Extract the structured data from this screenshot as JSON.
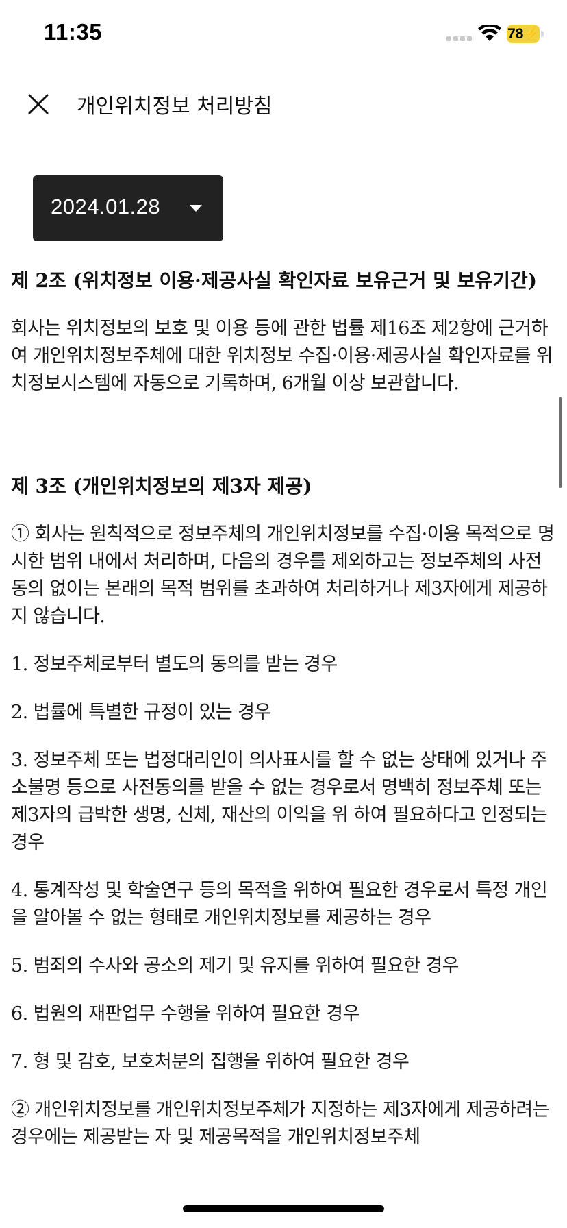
{
  "status_bar": {
    "time": "11:35",
    "battery_level": "78",
    "icons": [
      "cellular-signal-icon",
      "wifi-icon",
      "battery-charging-icon"
    ]
  },
  "header": {
    "title": "개인위치정보 처리방침",
    "close_icon": "close-icon"
  },
  "date_select": {
    "value": "2024.01.28",
    "icon": "caret-down-icon"
  },
  "articles": [
    {
      "title": "제 2조 (위치정보 이용·제공사실 확인자료 보유근거 및 보유기간)",
      "paragraphs": [
        "회사는 위치정보의 보호 및 이용 등에 관한 법률 제16조 제2항에 근거하여 개인위치정보주체에 대한 위치정보 수집·이용·제공사실 확인자료를 위치정보시스템에 자동으로 기록하며, 6개월 이상 보관합니다."
      ]
    },
    {
      "title": "제 3조 (개인위치정보의 제3자 제공)",
      "paragraphs": [
        "① 회사는 원칙적으로 정보주체의 개인위치정보를 수집·이용 목적으로 명시한 범위 내에서 처리하며, 다음의 경우를 제외하고는 정보주체의 사전 동의 없이는 본래의 목적 범위를 초과하여 처리하거나 제3자에게 제공하지 않습니다.",
        "1. 정보주체로부터 별도의 동의를 받는 경우",
        "2. 법률에 특별한 규정이 있는 경우",
        "3. 정보주체 또는 법정대리인이 의사표시를 할 수 없는 상태에 있거나 주소불명 등으로 사전동의를 받을 수 없는 경우로서 명백히 정보주체 또는 제3자의 급박한 생명, 신체, 재산의 이익을 위 하여 필요하다고 인정되는 경우",
        "4. 통계작성 및 학술연구 등의 목적을 위하여 필요한 경우로서 특정 개인을 알아볼 수 없는  형태로 개인위치정보를 제공하는 경우",
        "5. 범죄의 수사와 공소의 제기 및 유지를 위하여 필요한 경우",
        "6. 법원의 재판업무 수행을 위하여 필요한 경우",
        "7. 형 및 감호, 보호처분의 집행을 위하여 필요한 경우",
        "② 개인위치정보를 개인위치정보주체가 지정하는 제3자에게 제공하려는 경우에는 제공받는 자 및 제공목적을 개인위치정보주체"
      ]
    }
  ],
  "colors": {
    "dropdown_bg": "#222222",
    "battery": "#f2d23c",
    "text": "#111111"
  }
}
